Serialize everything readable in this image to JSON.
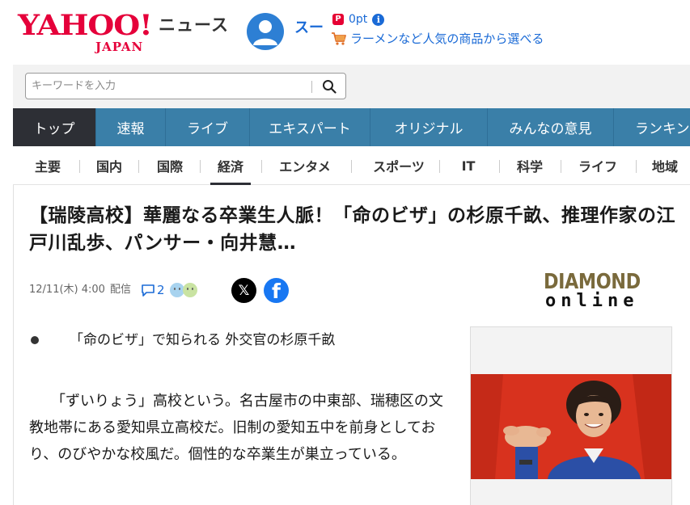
{
  "header": {
    "logo_text": "YAHOO!",
    "logo_sub": "JAPAN",
    "service_name": "ニュース",
    "user_name": "スー",
    "points": "0pt",
    "info_glyph": "i",
    "promo": "ラーメンなど人気の商品から選べる",
    "paypay_glyph": "P"
  },
  "search": {
    "placeholder": "キーワードを入力"
  },
  "main_nav": {
    "tabs": [
      {
        "label": "トップ",
        "active": true
      },
      {
        "label": "速報",
        "active": false
      },
      {
        "label": "ライブ",
        "active": false
      },
      {
        "label": "エキスパート",
        "active": false
      },
      {
        "label": "オリジナル",
        "active": false
      },
      {
        "label": "みんなの意見",
        "active": false
      },
      {
        "label": "ランキング",
        "active": false
      }
    ]
  },
  "sub_nav": {
    "items": [
      {
        "label": "主要"
      },
      {
        "label": "国内"
      },
      {
        "label": "国際"
      },
      {
        "label": "経済"
      },
      {
        "label": "エンタメ"
      },
      {
        "label": "スポーツ"
      },
      {
        "label": "IT"
      },
      {
        "label": "科学"
      },
      {
        "label": "ライフ"
      },
      {
        "label": "地域"
      }
    ],
    "active_label": "経済"
  },
  "article": {
    "headline": "【瑞陵高校】華麗なる卒業生人脈！「命のビザ」の杉原千畝、推理作家の江戸川乱歩、パンサー・向井慧…",
    "date": "12/11(木) 4:00",
    "date_label": "配信",
    "comment_count": "2",
    "share_x_glyph": "𝕏",
    "share_fb_glyph": "f",
    "source_logo_top": "DIAMOND",
    "source_logo_bottom": "online",
    "bullet": "「命のビザ」で知られる 外交官の杉原千畝",
    "paragraph": "「ずいりょう」高校という。名古屋市の中東部、瑞穂区の文教地帯にある愛知県立高校だ。旧制の愛知五中を前身としており、のびやかな校風だ。個性的な卒業生が巣立っている。"
  },
  "colors": {
    "brand_red": "#e5003a",
    "link_blue": "#1a6ad6",
    "nav_blue": "#3a7fa8",
    "nav_active": "#2d2f35",
    "photo_red": "#d8321e"
  },
  "icons": {
    "avatar": "user-avatar-icon",
    "points": "paypay-icon",
    "info": "info-icon",
    "cart": "cart-icon",
    "search": "search-icon",
    "comment": "comment-icon",
    "share_x": "x-icon",
    "share_fb": "facebook-icon"
  }
}
